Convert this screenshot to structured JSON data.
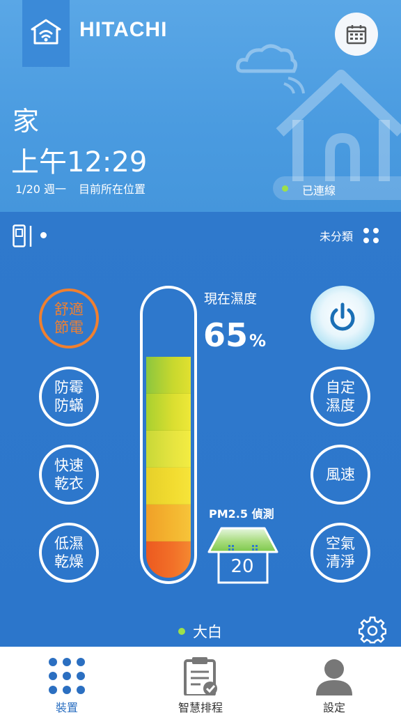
{
  "header": {
    "brand": "HITACHI",
    "location": "家",
    "time": "上午12:29",
    "date": "1/20 週一",
    "position_label": "目前所在位置",
    "connection": "已連線",
    "icons": [
      "wifi-home-icon",
      "calendar-icon"
    ]
  },
  "device": {
    "category": "未分類",
    "name": "大白",
    "modes_left": [
      {
        "label_1": "舒適",
        "label_2": "節電",
        "active": true
      },
      {
        "label_1": "防霉",
        "label_2": "防蟎",
        "active": false
      },
      {
        "label_1": "快速",
        "label_2": "乾衣",
        "active": false
      },
      {
        "label_1": "低濕",
        "label_2": "乾燥",
        "active": false
      }
    ],
    "modes_right": [
      {
        "label_1": "自定",
        "label_2": "濕度"
      },
      {
        "label": "風速"
      },
      {
        "label_1": "空氣",
        "label_2": "清淨"
      }
    ],
    "humidity_label": "現在濕度",
    "humidity_value": "65",
    "humidity_unit": "%",
    "pm_label": "PM2.5 偵測",
    "pm_value": "20",
    "colors": {
      "active_mode": "#f08030",
      "status_dot": "#9de04a"
    }
  },
  "nav": {
    "items": [
      {
        "label": "裝置",
        "icon": "grid-dots-icon",
        "active": true
      },
      {
        "label": "智慧排程",
        "icon": "schedule-clipboard-icon",
        "active": false
      },
      {
        "label": "設定",
        "icon": "user-icon",
        "active": false
      }
    ]
  }
}
